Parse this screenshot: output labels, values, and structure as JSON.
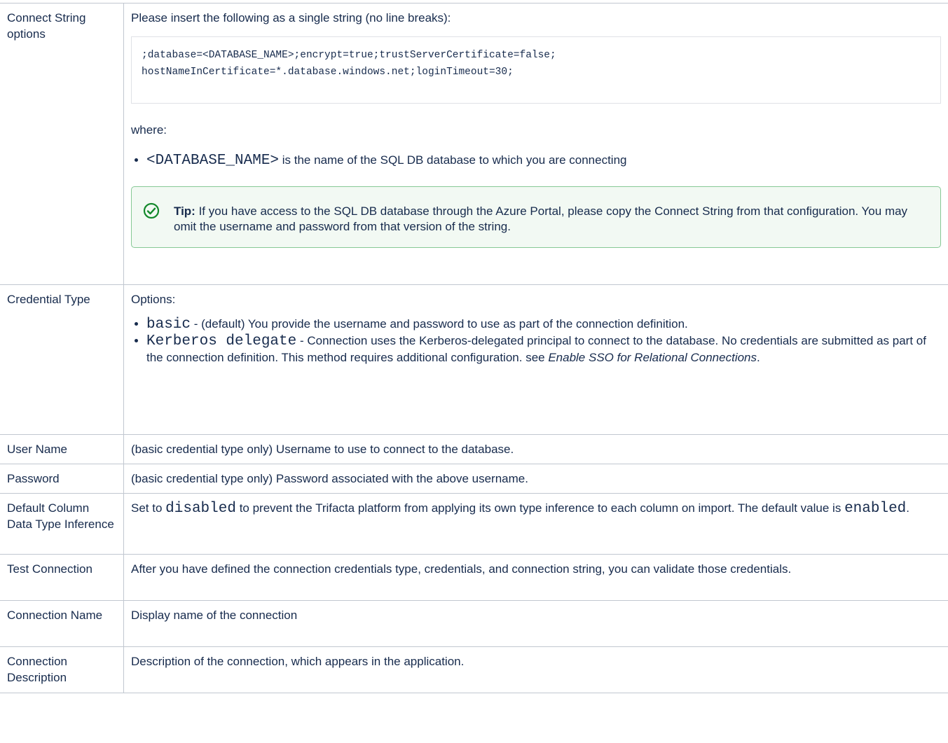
{
  "rows": [
    {
      "key": "Connect String options",
      "intro": "Please insert the following as a single string (no line breaks):",
      "code_line1": ";database=<DATABASE_NAME>;encrypt=true;trustServerCertificate=false;",
      "code_line2": "hostNameInCertificate=*.database.windows.net;loginTimeout=30;",
      "where": "where:",
      "bullet_code": "<DATABASE_NAME>",
      "bullet_text": " is the name of the SQL DB database to which you are connecting",
      "tip_label": "Tip:",
      "tip_text": " If you have access to the SQL DB database through the Azure Portal, please copy the Connect String from that configuration. You may omit the username and password from that version of the string."
    },
    {
      "key": "Credential Type",
      "intro": "Options:",
      "opt1_code": "basic",
      "opt1_text": " - (default) You provide the username and password to use as part of the connection definition.",
      "opt2_code": "Kerberos delegate",
      "opt2_text": " - Connection uses the Kerberos-delegated principal to connect to the database. No credentials are submitted as part of the connection definition. This method requires additional configuration. see ",
      "opt2_link": "Enable SSO for Relational Connections",
      "opt2_end": "."
    },
    {
      "key": "User Name",
      "value": "(basic credential type only) Username to use to connect to the database."
    },
    {
      "key": "Password",
      "value": "(basic credential type only) Password associated with the above username."
    },
    {
      "key": "Default Column Data Type Inference",
      "pre": "Set to ",
      "code1": "disabled",
      "mid": " to prevent the Trifacta platform from applying its own type inference to each column on import. The default value is ",
      "code2": "enabled",
      "end": "."
    },
    {
      "key": "Test Connection",
      "value": "After you have defined the connection credentials type, credentials, and connection string, you can validate those credentials."
    },
    {
      "key": "Connection Name",
      "value": "Display name of the connection"
    },
    {
      "key": "Connection Description",
      "value": "Description of the connection, which appears in the application."
    }
  ],
  "colors": {
    "border": "#c1c7d0",
    "tip_border": "#86c995",
    "tip_bg": "#f2f9f3",
    "tip_icon": "#14892c"
  },
  "icons": {
    "tip": "check-circle-icon"
  }
}
